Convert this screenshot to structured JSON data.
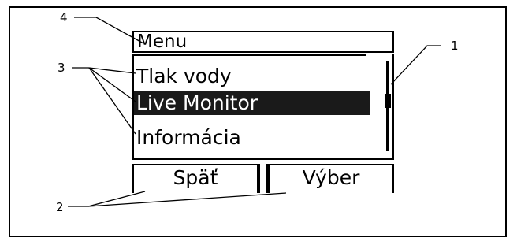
{
  "screen": {
    "title": "Menu",
    "items": [
      {
        "label": "Tlak vody",
        "selected": false
      },
      {
        "label": "Live Monitor",
        "selected": true
      },
      {
        "label": "Informácia",
        "selected": false
      }
    ],
    "softkeys": {
      "left": "Späť",
      "right": "Výber"
    }
  },
  "callouts": {
    "n1": "1",
    "n2": "2",
    "n3": "3",
    "n4": "4"
  }
}
